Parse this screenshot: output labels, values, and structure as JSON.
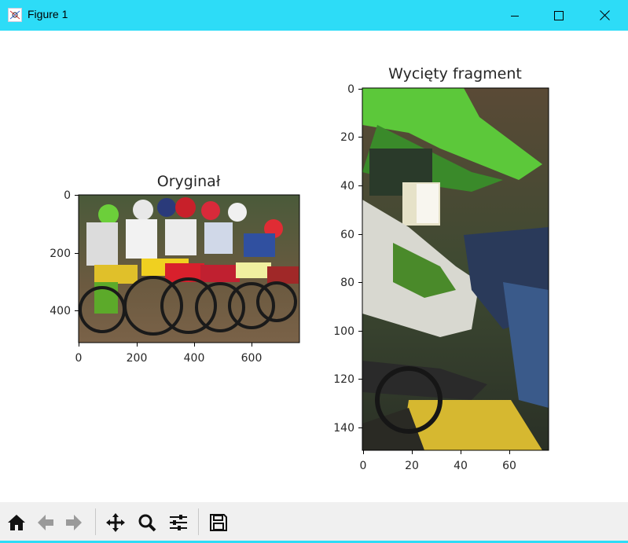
{
  "window": {
    "title": "Figure 1",
    "accent_color": "#2ddcf7"
  },
  "figure": {
    "left_plot": {
      "title": "Oryginał",
      "x_ticks": [
        "0",
        "200",
        "400",
        "600"
      ],
      "y_ticks": [
        "0",
        "200",
        "400"
      ]
    },
    "right_plot": {
      "title": "Wycięty fragment",
      "x_ticks": [
        "0",
        "20",
        "40",
        "60"
      ],
      "y_ticks": [
        "0",
        "20",
        "40",
        "60",
        "80",
        "100",
        "120",
        "140"
      ]
    }
  },
  "toolbar": {
    "buttons": [
      "home-icon",
      "back-arrow-icon",
      "forward-arrow-icon",
      "pan-icon",
      "zoom-icon",
      "configure-subplots-icon",
      "save-icon"
    ]
  }
}
